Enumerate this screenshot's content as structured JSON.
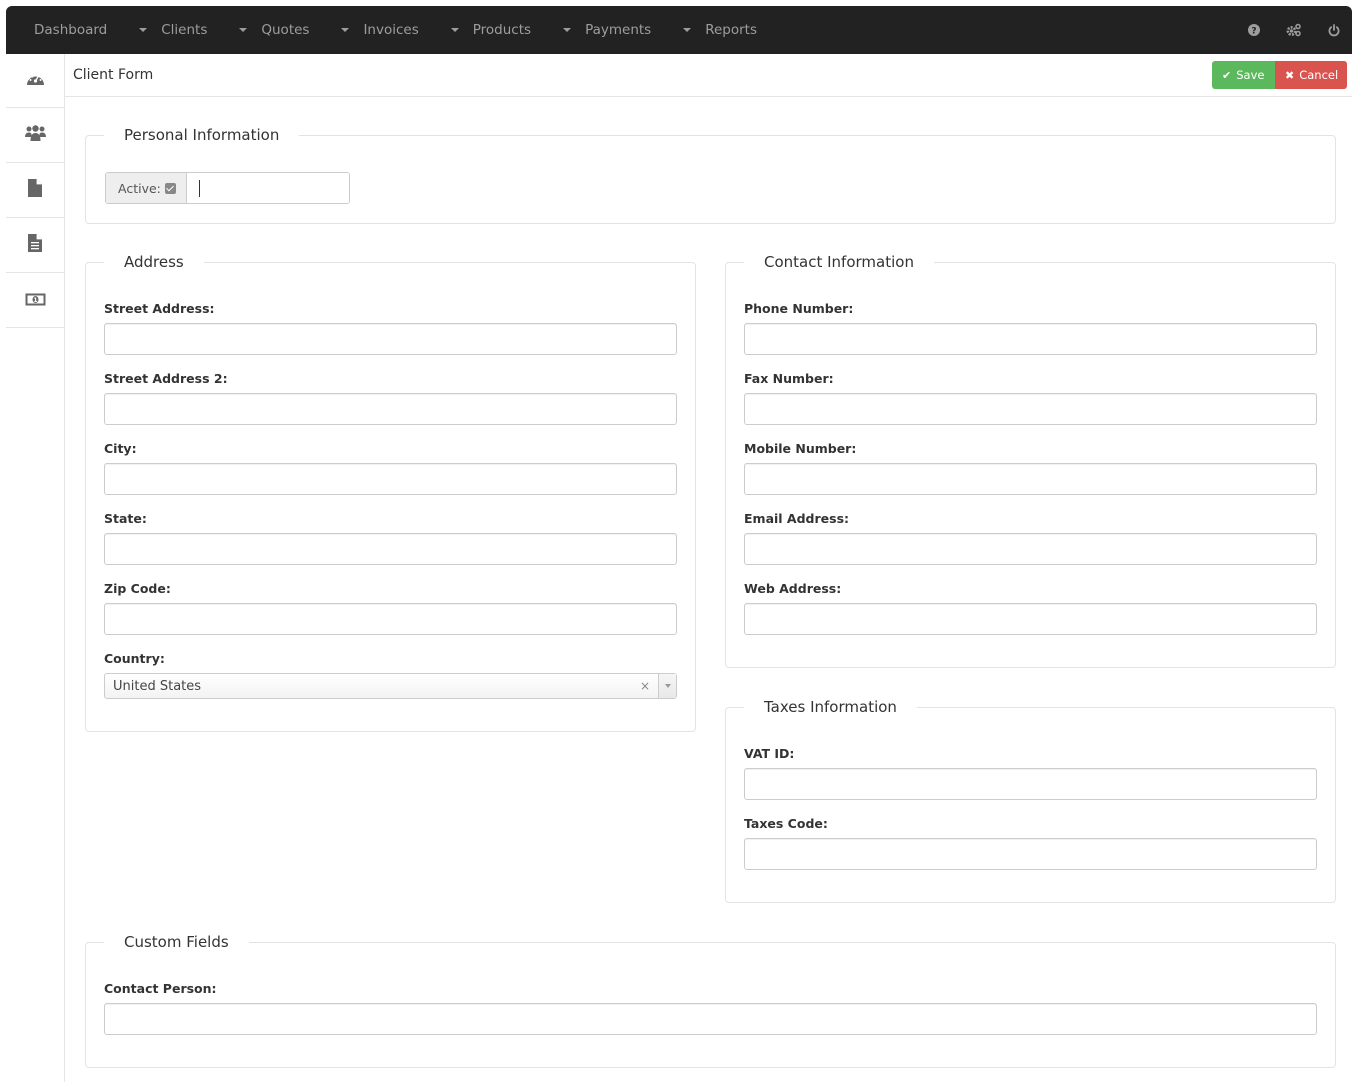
{
  "nav": {
    "items": [
      {
        "label": "Dashboard",
        "dropdown": false
      },
      {
        "label": "Clients",
        "dropdown": true
      },
      {
        "label": "Quotes",
        "dropdown": true
      },
      {
        "label": "Invoices",
        "dropdown": true
      },
      {
        "label": "Products",
        "dropdown": true
      },
      {
        "label": "Payments",
        "dropdown": true
      },
      {
        "label": "Reports",
        "dropdown": true
      }
    ],
    "right_icons": [
      "help-icon",
      "settings-icon",
      "power-icon"
    ]
  },
  "sidebar": {
    "items": [
      {
        "icon": "dashboard-icon"
      },
      {
        "icon": "clients-icon"
      },
      {
        "icon": "quotes-icon"
      },
      {
        "icon": "invoices-icon"
      },
      {
        "icon": "payments-icon"
      }
    ]
  },
  "header": {
    "title": "Client Form",
    "save_label": "Save",
    "cancel_label": "Cancel",
    "save_color": "#5cb85c",
    "cancel_color": "#d9534f"
  },
  "personal": {
    "legend": "Personal Information",
    "active_label": "Active:",
    "active_checked": true,
    "name_value": ""
  },
  "address": {
    "legend": "Address",
    "fields": [
      {
        "label": "Street Address:",
        "value": ""
      },
      {
        "label": "Street Address 2:",
        "value": ""
      },
      {
        "label": "City:",
        "value": ""
      },
      {
        "label": "State:",
        "value": ""
      },
      {
        "label": "Zip Code:",
        "value": ""
      }
    ],
    "country_label": "Country:",
    "country_value": "United States",
    "country_clear": "×"
  },
  "contact": {
    "legend": "Contact Information",
    "fields": [
      {
        "label": "Phone Number:",
        "value": ""
      },
      {
        "label": "Fax Number:",
        "value": ""
      },
      {
        "label": "Mobile Number:",
        "value": ""
      },
      {
        "label": "Email Address:",
        "value": ""
      },
      {
        "label": "Web Address:",
        "value": ""
      }
    ]
  },
  "taxes": {
    "legend": "Taxes Information",
    "fields": [
      {
        "label": "VAT ID:",
        "value": ""
      },
      {
        "label": "Taxes Code:",
        "value": ""
      }
    ]
  },
  "custom": {
    "legend": "Custom Fields",
    "fields": [
      {
        "label": "Contact Person:",
        "value": ""
      }
    ]
  }
}
